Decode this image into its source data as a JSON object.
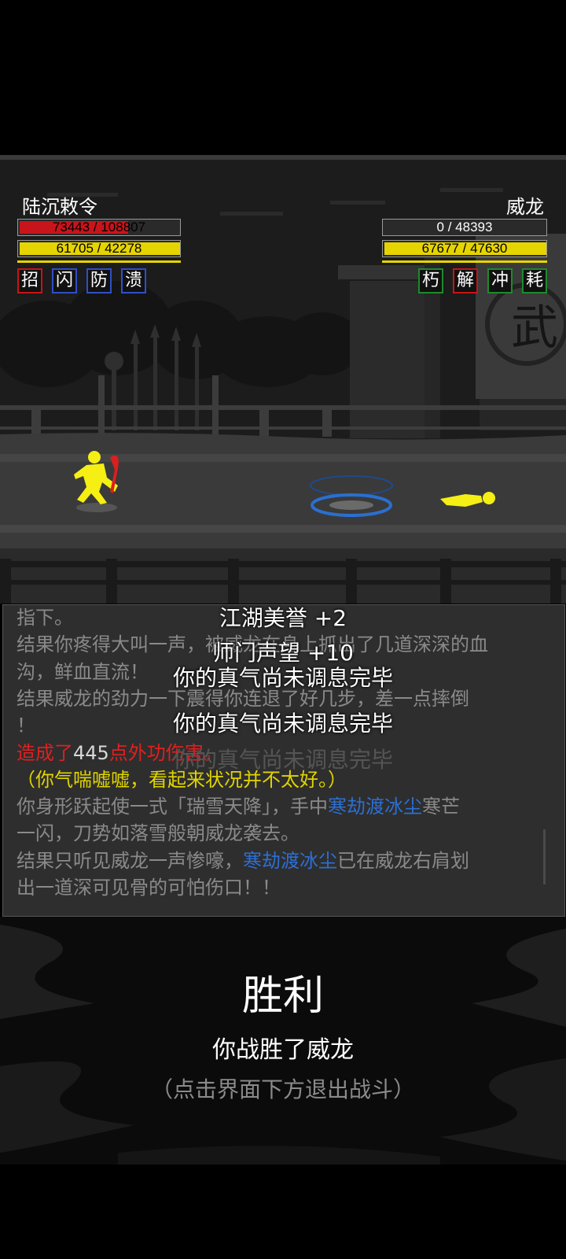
{
  "player": {
    "name": "陆沉敕令",
    "hp_text": "73443 / 108807",
    "hp_fraction": 0.675,
    "qi_text": "61705 / 42278",
    "qi_fraction": 1.0,
    "skills": [
      "招",
      "闪",
      "防",
      "溃"
    ],
    "hp_color": "#c8141b",
    "qi_color": "#e6d400"
  },
  "enemy": {
    "name": "威龙",
    "hp_text": "0 / 48393",
    "hp_fraction": 0.0,
    "qi_text": "67677 / 47630",
    "qi_fraction": 1.0,
    "skills": [
      "朽",
      "解",
      "冲",
      "耗"
    ]
  },
  "scene": {
    "banner_char": "武"
  },
  "log": {
    "lines": [
      [
        {
          "t": "指下。",
          "c": ""
        }
      ],
      [
        {
          "t": "结果你疼得大叫一声",
          "c": ""
        },
        {
          "t": "，被威龙在身上抓出了几道深深的血",
          "c": ""
        }
      ],
      [
        {
          "t": "沟，鲜血直流！",
          "c": ""
        }
      ],
      [
        {
          "t": "结果威龙的劲力一下震得你连退了好几步，差一点摔倒",
          "c": ""
        }
      ],
      [
        {
          "t": "！",
          "c": ""
        }
      ],
      [
        {
          "t": "造成了",
          "c": "red"
        },
        {
          "t": "445",
          "c": "white"
        },
        {
          "t": "点外功伤害。",
          "c": "red"
        }
      ],
      [
        {
          "t": "（你气喘嘘嘘，看起来状况并不太好。）",
          "c": "yellow"
        }
      ],
      [
        {
          "t": "你身形跃起使一式「瑞雪天降」，手中",
          "c": ""
        },
        {
          "t": "寒劫渡冰尘",
          "c": "blue"
        },
        {
          "t": "寒芒",
          "c": ""
        }
      ],
      [
        {
          "t": "一闪，刀势如落雪般朝威龙袭去。",
          "c": ""
        }
      ],
      [
        {
          "t": "结果只听见威龙一声惨嚎，",
          "c": ""
        },
        {
          "t": "寒劫渡冰尘",
          "c": "blue"
        },
        {
          "t": "已在威龙右肩划",
          "c": ""
        }
      ],
      [
        {
          "t": "出一道深可见骨的可怕伤口！！",
          "c": ""
        }
      ]
    ]
  },
  "popups": {
    "line1": "江湖美誉 +2",
    "line2": "师门声望 +10",
    "line3": "你的真气尚未调息完毕",
    "line4": "你的真气尚未调息完毕",
    "line5": "你的真气尚未调息完毕"
  },
  "victory": {
    "title": "胜利",
    "subtitle": "你战胜了威龙",
    "hint": "（点击界面下方退出战斗）"
  }
}
